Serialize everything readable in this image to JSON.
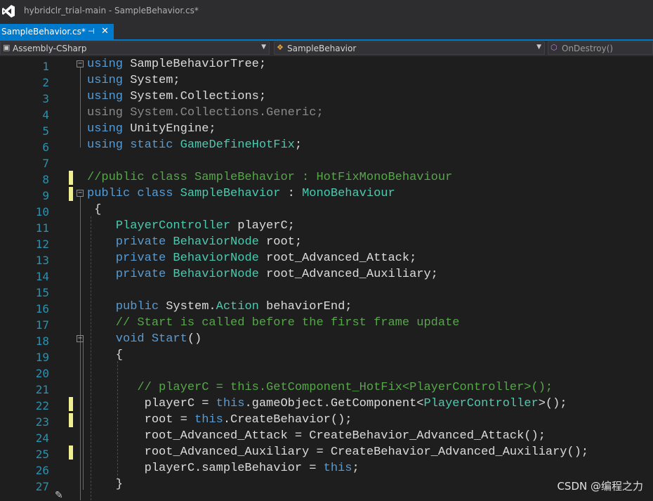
{
  "window": {
    "title": "hybridclr_trial-main - SampleBehavior.cs*"
  },
  "tab": {
    "label": "SampleBehavior.cs*",
    "pin_icon": "pin-icon",
    "close_icon": "close-icon"
  },
  "navbar": {
    "project": "Assembly-CSharp",
    "type": "SampleBehavior",
    "member": "OnDestroy()"
  },
  "line_numbers": [
    "1",
    "2",
    "3",
    "4",
    "5",
    "6",
    "7",
    "8",
    "9",
    "10",
    "11",
    "12",
    "13",
    "14",
    "15",
    "16",
    "17",
    "18",
    "19",
    "20",
    "21",
    "22",
    "23",
    "24",
    "25",
    "26",
    "27"
  ],
  "code": {
    "l1a": "using",
    "l1b": " SampleBehaviorTree;",
    "l2a": "using",
    "l2b": " System;",
    "l3a": "using",
    "l3b": " System.Collections;",
    "l4": "using System.Collections.Generic;",
    "l5a": "using",
    "l5b": " UnityEngine;",
    "l6a": "using",
    "l6b": " static ",
    "l6c": "GameDefineHotFix",
    "l6d": ";",
    "l8": "//public class SampleBehavior : HotFixMonoBehaviour",
    "l9a": "public class ",
    "l9b": "SampleBehavior",
    "l9c": " : ",
    "l9d": "MonoBehaviour",
    "l10": " {",
    "l11a": "    ",
    "l11b": "PlayerController",
    "l11c": " playerC;",
    "l12a": "    private ",
    "l12b": "BehaviorNode",
    "l12c": " root;",
    "l13a": "    private ",
    "l13b": "BehaviorNode",
    "l13c": " root_Advanced_Attack;",
    "l14a": "    private ",
    "l14b": "BehaviorNode",
    "l14c": " root_Advanced_Auxiliary;",
    "l16a": "    public ",
    "l16b": "System.",
    "l16c": "Action",
    "l16d": " behaviorEnd;",
    "l17": "    // Start is called before the first frame update",
    "l18a": "    void ",
    "l18b": "Start",
    "l18c": "()",
    "l19": "    {",
    "l21": "       // playerC = this.GetComponent_HotFix<PlayerController>();",
    "l22a": "        playerC = ",
    "l22b": "this",
    "l22c": ".gameObject.GetComponent<",
    "l22d": "PlayerController",
    "l22e": ">();",
    "l23a": "        root = ",
    "l23b": "this",
    "l23c": ".CreateBehavior();",
    "l24": "        root_Advanced_Attack = CreateBehavior_Advanced_Attack();",
    "l25": "        root_Advanced_Auxiliary = CreateBehavior_Advanced_Auxiliary();",
    "l26a": "        playerC.sampleBehavior = ",
    "l26b": "this",
    "l26c": ";",
    "l27": "    }"
  },
  "watermark": "CSDN @编程之力",
  "colors": {
    "accent": "#007acc",
    "keyword": "#569cd6",
    "type": "#4ec9b0",
    "comment": "#57a64a",
    "line_number": "#2b91af",
    "change_mark": "#efef91"
  }
}
